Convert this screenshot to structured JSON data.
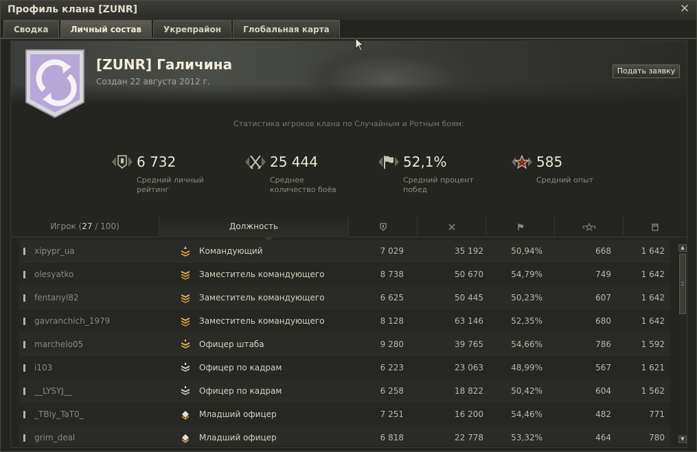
{
  "window": {
    "title": "Профиль клана [ZUNR]",
    "close": "✕"
  },
  "tabs": [
    {
      "label": "Сводка",
      "active": false
    },
    {
      "label": "Личный состав",
      "active": true
    },
    {
      "label": "Укрепрайон",
      "active": false
    },
    {
      "label": "Глобальная карта",
      "active": false
    }
  ],
  "clan": {
    "name": "[ZUNR] Галичина",
    "created": "Создан 22 августа 2012 г.",
    "apply_button": "Подать заявку"
  },
  "stats": {
    "caption": "Статистика игроков клана по Случайным и Ротным боям:",
    "items": [
      {
        "icon": "rating-shield-icon",
        "value": "6 732",
        "label_1": "Средний личный",
        "label_2": "рейтинг"
      },
      {
        "icon": "crossed-swords-icon",
        "value": "25 444",
        "label_1": "Среднее",
        "label_2": "количество боёв"
      },
      {
        "icon": "flag-icon",
        "value": "52,1%",
        "label_1": "Средний процент",
        "label_2": "побед"
      },
      {
        "icon": "star-icon",
        "value": "585",
        "label_1": "Средний опыт",
        "label_2": ""
      }
    ]
  },
  "table": {
    "headers": {
      "player_label": "Игрок (",
      "player_count": "27",
      "player_total": " / 100)",
      "role": "Должность"
    },
    "rows": [
      {
        "name": "xipypr_ua",
        "rank_icon": "rank-commander-icon",
        "role": "Командующий",
        "rating": "7 029",
        "battles": "35 192",
        "wins": "50,94%",
        "xp": "668",
        "days": "1 642"
      },
      {
        "name": "olesyatko",
        "rank_icon": "rank-deputy-icon",
        "role": "Заместитель командующего",
        "rating": "8 738",
        "battles": "50 670",
        "wins": "54,79%",
        "xp": "749",
        "days": "1 642"
      },
      {
        "name": "fentanyl82",
        "rank_icon": "rank-deputy-icon",
        "role": "Заместитель командующего",
        "rating": "6 625",
        "battles": "50 445",
        "wins": "50,23%",
        "xp": "607",
        "days": "1 642"
      },
      {
        "name": "gavranchich_1979",
        "rank_icon": "rank-deputy-icon",
        "role": "Заместитель командующего",
        "rating": "8 128",
        "battles": "63 146",
        "wins": "52,35%",
        "xp": "680",
        "days": "1 642"
      },
      {
        "name": "marchelo05",
        "rank_icon": "rank-staff-officer-icon",
        "role": "Офицер штаба",
        "rating": "9 280",
        "battles": "39 765",
        "wins": "54,66%",
        "xp": "786",
        "days": "1 592"
      },
      {
        "name": "i103",
        "rank_icon": "rank-personnel-officer-icon",
        "role": "Офицер по кадрам",
        "rating": "6 223",
        "battles": "23 063",
        "wins": "48,99%",
        "xp": "567",
        "days": "1 621"
      },
      {
        "name": "__LYSYJ__",
        "rank_icon": "rank-personnel-officer-icon",
        "role": "Офицер по кадрам",
        "rating": "6 258",
        "battles": "18 822",
        "wins": "50,42%",
        "xp": "604",
        "days": "1 562"
      },
      {
        "name": "_TBiy_TaT0_",
        "rank_icon": "rank-junior-officer-icon",
        "role": "Младший офицер",
        "rating": "7 251",
        "battles": "16 200",
        "wins": "54,46%",
        "xp": "482",
        "days": "771"
      },
      {
        "name": "grim_deal",
        "rank_icon": "rank-junior-officer-icon",
        "role": "Младший офицер",
        "rating": "6 818",
        "battles": "22 778",
        "wins": "53,32%",
        "xp": "464",
        "days": "780"
      }
    ]
  },
  "colors": {
    "accent_text": "#ebe6d5",
    "muted_text": "#8e8a7d",
    "emblem_purple": "#b8a9d9",
    "rank_gold": "#d9a33a"
  }
}
